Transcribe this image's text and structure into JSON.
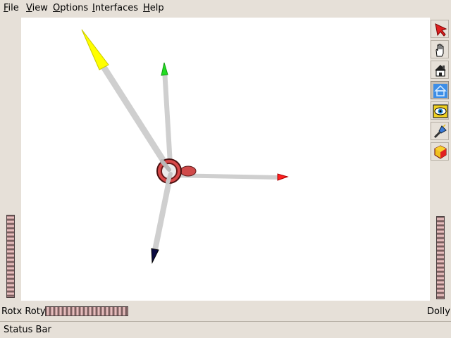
{
  "menu": {
    "file": "File",
    "view": "View",
    "options": "Options",
    "interfaces": "Interfaces",
    "help": "Help"
  },
  "toolbar": {
    "tools": [
      "select-arrow-icon",
      "pan-hand-icon",
      "home-icon",
      "set-home-icon",
      "view-all-icon",
      "seek-flashlight-icon",
      "projection-cube-icon"
    ],
    "pressed_tool": "set-home-icon"
  },
  "scene": {
    "axes": [
      {
        "name": "yellow-axis",
        "tip_color": "#ffff00"
      },
      {
        "name": "green-axis",
        "tip_color": "#22dd22"
      },
      {
        "name": "red-axis",
        "tip_color": "#ff2020"
      },
      {
        "name": "blue-axis",
        "tip_color": "#0a0a40"
      }
    ],
    "shaft_color": "#cfcfcf",
    "origin_color": "#c23a3a"
  },
  "labels": {
    "rotx_roty": "Rotx Roty",
    "dolly": "Dolly"
  },
  "status": {
    "text": "Status Bar"
  }
}
